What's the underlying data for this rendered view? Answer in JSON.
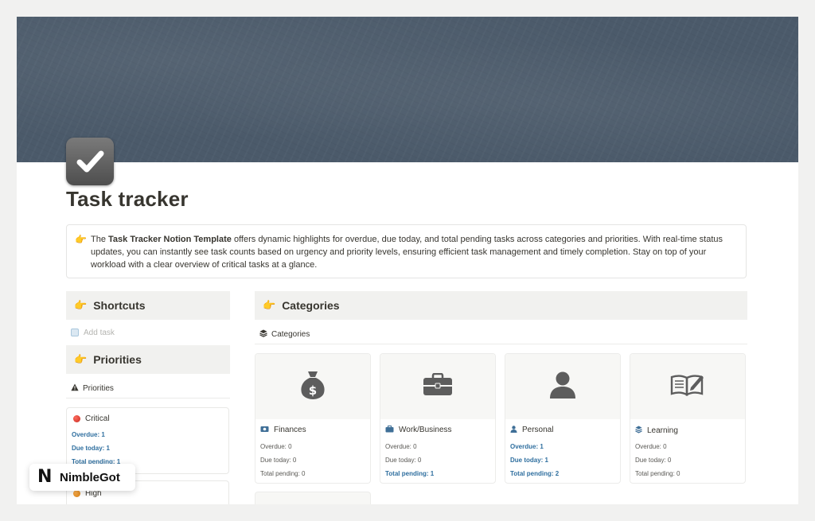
{
  "page": {
    "title": "Task tracker",
    "icon": "checkbox-checked-icon"
  },
  "callout": {
    "icon": "pointing-hand-icon",
    "intro": "The ",
    "bold": "Task Tracker Notion Template",
    "rest": " offers dynamic highlights for overdue, due today, and total pending tasks across categories and priorities. With real-time status updates, you can instantly see task counts based on urgency and priority levels, ensuring efficient task management and timely completion. Stay on top of your workload with a clear overview of critical tasks at a glance."
  },
  "shortcuts": {
    "header": "Shortcuts",
    "add_task": "Add task"
  },
  "priorities": {
    "header": "Priorities",
    "view_label": "Priorities",
    "items": [
      {
        "name": "Critical",
        "color": "#d6312b",
        "overdue": "Overdue: 1",
        "due_today": "Due today: 1",
        "total_pending": "Total pending: 1"
      },
      {
        "name": "High",
        "color": "#e08a1e"
      }
    ]
  },
  "categories": {
    "header": "Categories",
    "view_label": "Categories",
    "items": [
      {
        "name": "Finances",
        "icon": "money-bag-icon",
        "small_icon": "cash-icon",
        "overdue": "Overdue: 0",
        "due_today": "Due today: 0",
        "total_pending": "Total pending: 0",
        "highlight": [
          false,
          false,
          false
        ]
      },
      {
        "name": "Work/Business",
        "icon": "briefcase-icon",
        "small_icon": "briefcase-icon",
        "overdue": "Overdue: 0",
        "due_today": "Due today: 0",
        "total_pending": "Total pending: 1",
        "highlight": [
          false,
          false,
          true
        ]
      },
      {
        "name": "Personal",
        "icon": "person-icon",
        "small_icon": "person-icon",
        "overdue": "Overdue: 1",
        "due_today": "Due today: 1",
        "total_pending": "Total pending: 2",
        "highlight": [
          true,
          true,
          true
        ]
      },
      {
        "name": "Learning",
        "icon": "open-book-icon",
        "small_icon": "stack-icon",
        "overdue": "Overdue: 0",
        "due_today": "Due today: 0",
        "total_pending": "Total pending: 0",
        "highlight": [
          false,
          false,
          false
        ]
      }
    ]
  },
  "watermark": {
    "logo_letter": "N",
    "text": "NimbleGot"
  },
  "colors": {
    "link_blue": "#2f6f9f",
    "header_bg": "#f1f1ef",
    "cover": "#4b5a6a"
  }
}
